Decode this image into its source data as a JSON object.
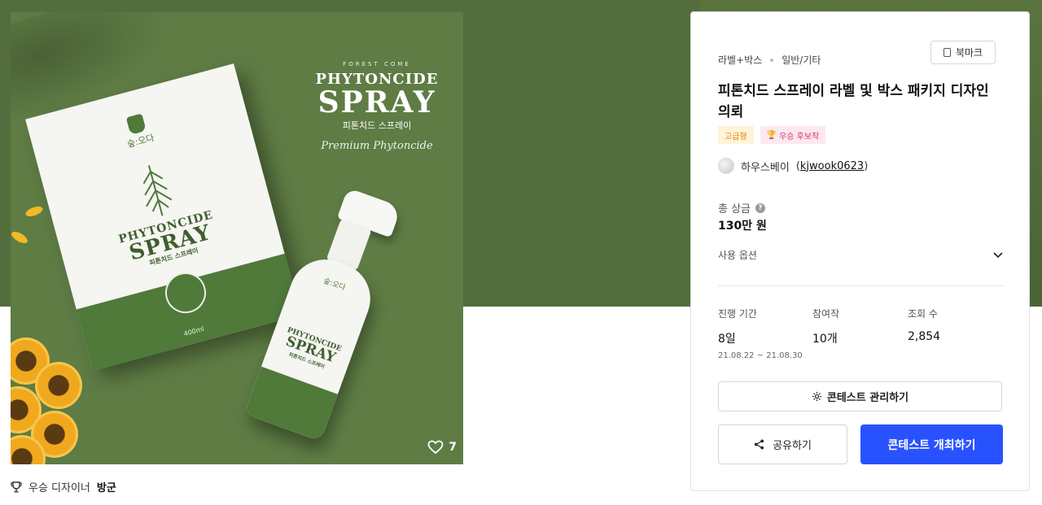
{
  "artwork": {
    "title_forest": "FOREST COME",
    "title_en": "PHYTONCIDE",
    "title_spray": "SPRAY",
    "title_kr": "피톤치드 스프레이",
    "title_script": "Premium Phytoncide",
    "brand_kr": "숲:오다",
    "box_small_a": "PHYTONCIDE",
    "box_small_b": "SPRAY",
    "box_small_c": "피톤치드 스프레이",
    "volume": "400ml",
    "likes": "7"
  },
  "winner": {
    "label": "우승 디자이너",
    "name": "방군"
  },
  "panel": {
    "breadcrumb": [
      "라벨+박스",
      "일반/기타"
    ],
    "bookmark_label": "북마크",
    "title": "피톤치드 스프레이 라벨 및 박스 패키지 디자인 의뢰",
    "tags": {
      "grade": "고급형",
      "winner": "우승 후보작"
    },
    "author": {
      "name": "하우스베이",
      "id": "kjwook0623"
    },
    "prize": {
      "label": "총 상금",
      "help_icon": "?",
      "value": "130만 원"
    },
    "usage_label": "사용 옵션",
    "stats": {
      "period": {
        "label": "진행 기간",
        "value": "8일",
        "range": "21.08.22 ~ 21.08.30"
      },
      "entries": {
        "label": "참여작",
        "value": "10개"
      },
      "views": {
        "label": "조회 수",
        "value": "2,854"
      }
    },
    "manage_label": "콘테스트 관리하기",
    "share_label": "공유하기",
    "host_label": "콘테스트 개최하기"
  },
  "colors": {
    "accent": "#2952ff",
    "header_bg": "#546d3c",
    "art_green": "#5e7c44"
  }
}
